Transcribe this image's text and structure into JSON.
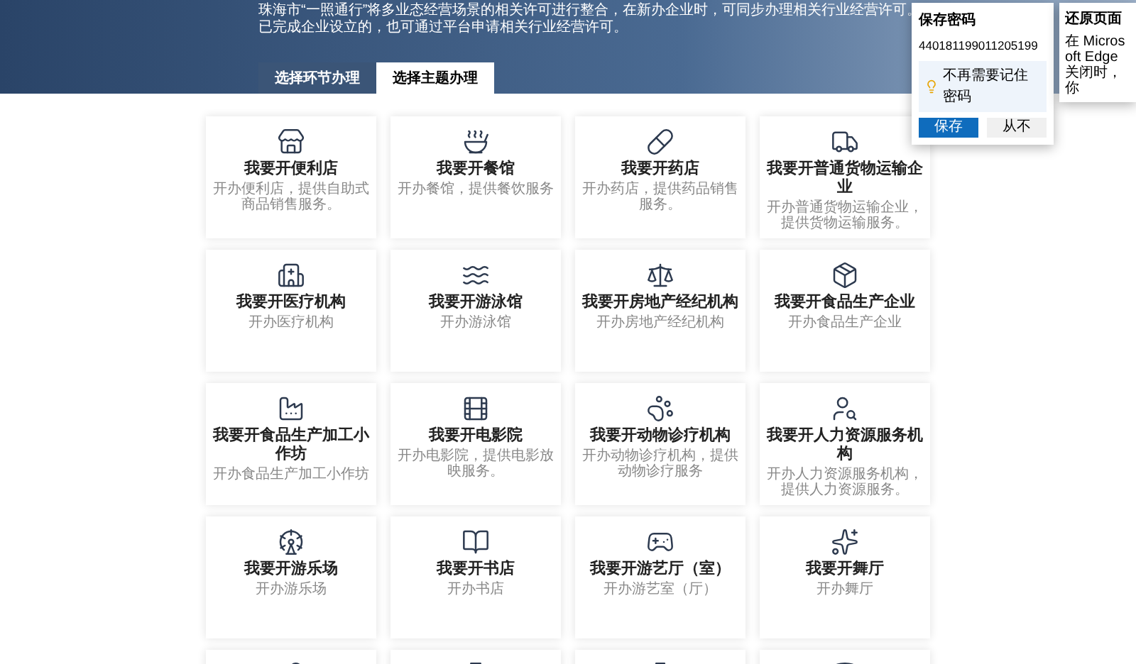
{
  "hero": {
    "lines": [
      "珠海市“一照通行”将多业态经营场景的相关许可进行整合，在新办企业时，可同步办理相关行业经营许可。",
      "已完成企业设立的，也可通过平台申请相关行业经营许可。"
    ]
  },
  "tabs": [
    {
      "label": "选择环节办理",
      "selected": false
    },
    {
      "label": "选择主题办理",
      "selected": true
    }
  ],
  "cards": [
    {
      "title": "我要开便利店",
      "description": "开办便利店，提供自助式商品销售服务。"
    },
    {
      "title": "我要开餐馆",
      "description": "开办餐馆，提供餐饮服务"
    },
    {
      "title": "我要开药店",
      "description": "开办药店，提供药品销售服务。"
    },
    {
      "title": "我要开普通货物运输企业",
      "description": "开办普通货物运输企业，提供货物运输服务。"
    },
    {
      "title": "我要开医疗机构",
      "description": "开办医疗机构"
    },
    {
      "title": "我要开游泳馆",
      "description": "开办游泳馆"
    },
    {
      "title": "我要开房地产经纪机构",
      "description": "开办房地产经纪机构"
    },
    {
      "title": "我要开食品生产企业",
      "description": "开办食品生产企业"
    },
    {
      "title": "我要开食品生产加工小作坊",
      "description": "开办食品生产加工小作坊"
    },
    {
      "title": "我要开电影院",
      "description": "开办电影院，提供电影放映服务。"
    },
    {
      "title": "我要开动物诊疗机构",
      "description": "开办动物诊疗机构，提供动物诊疗服务"
    },
    {
      "title": "我要开人力资源服务机构",
      "description": "开办人力资源服务机构，提供人力资源服务。"
    },
    {
      "title": "我要开游乐场",
      "description": "开办游乐场"
    },
    {
      "title": "我要开书店",
      "description": "开办书店"
    },
    {
      "title": "我要开游艺厅（室）",
      "description": "开办游艺室（厅）"
    },
    {
      "title": "我要开舞厅",
      "description": "开办舞厅"
    }
  ],
  "password_popup": {
    "title": "保存密码",
    "username": "440181199011205199",
    "hint": "不再需要记住密码",
    "buttons": [
      {
        "label": "保存",
        "kind": "primary"
      },
      {
        "label": "从不",
        "kind": "secondary"
      }
    ]
  },
  "restore_popup": {
    "title": "还原页面",
    "text": "在 Microsoft Edge 关闭时，你"
  }
}
